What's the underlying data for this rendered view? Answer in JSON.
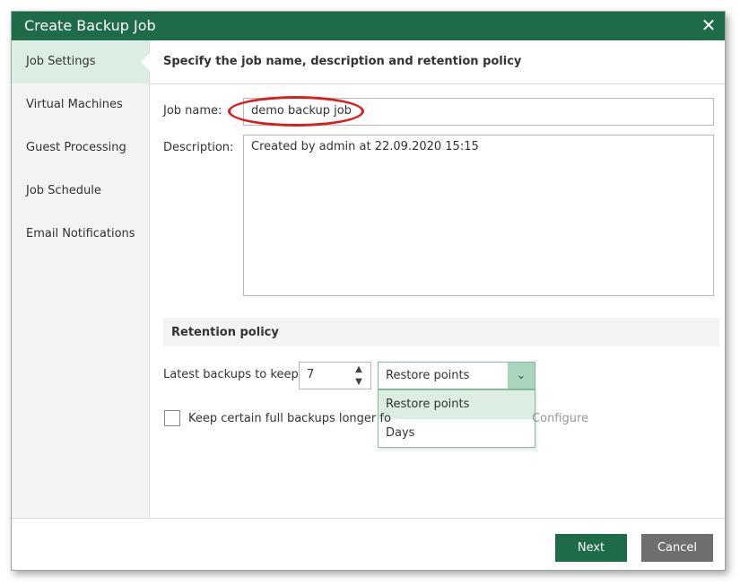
{
  "dialog": {
    "title": "Create Backup Job",
    "close_glyph": "✕"
  },
  "sidebar": {
    "items": [
      {
        "label": "Job Settings",
        "active": true
      },
      {
        "label": "Virtual Machines"
      },
      {
        "label": "Guest Processing"
      },
      {
        "label": "Job Schedule"
      },
      {
        "label": "Email Notifications"
      }
    ]
  },
  "main": {
    "section_title": "Specify the job name, description and retention policy",
    "job_name_label": "Job name:",
    "job_name_value": "demo backup job",
    "description_label": "Description:",
    "description_value": "Created by admin at 22.09.2020 15:15",
    "retention": {
      "title": "Retention policy",
      "latest_label": "Latest backups to keep:",
      "latest_value": "7",
      "unit_selected": "Restore points",
      "unit_options": [
        "Restore points",
        "Days"
      ],
      "keep_full_label": "Keep certain full backups longer fo",
      "configure_label": "Configure"
    }
  },
  "footer": {
    "next_label": "Next",
    "cancel_label": "Cancel"
  },
  "colors": {
    "accent": "#1e6b47",
    "selected_bg": "#dceee3",
    "highlight": "#d62020"
  }
}
